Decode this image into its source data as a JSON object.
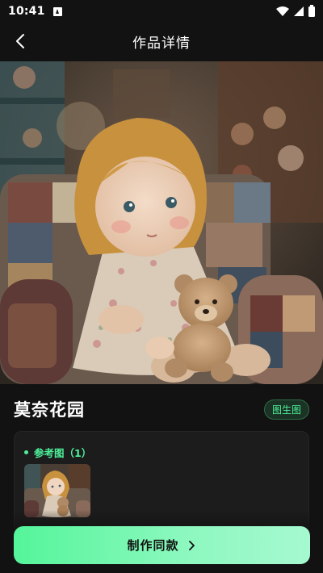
{
  "status_bar": {
    "time": "10:41",
    "icons": [
      "app-notification-icon",
      "wifi-icon",
      "signal-icon",
      "battery-icon"
    ]
  },
  "header": {
    "title": "作品详情",
    "back_icon": "chevron-left-icon"
  },
  "work": {
    "name": "莫奈花园",
    "type_badge": "图生图"
  },
  "reference": {
    "label": "参考图（1）"
  },
  "actions": {
    "make_same_label": "制作同款",
    "make_same_icon": "chevron-right-icon"
  },
  "colors": {
    "accent": "#4ef09a",
    "background": "#121212",
    "card": "#1c1c1c",
    "button_gradient_start": "#54f59a",
    "button_gradient_end": "#a6f9d0"
  }
}
